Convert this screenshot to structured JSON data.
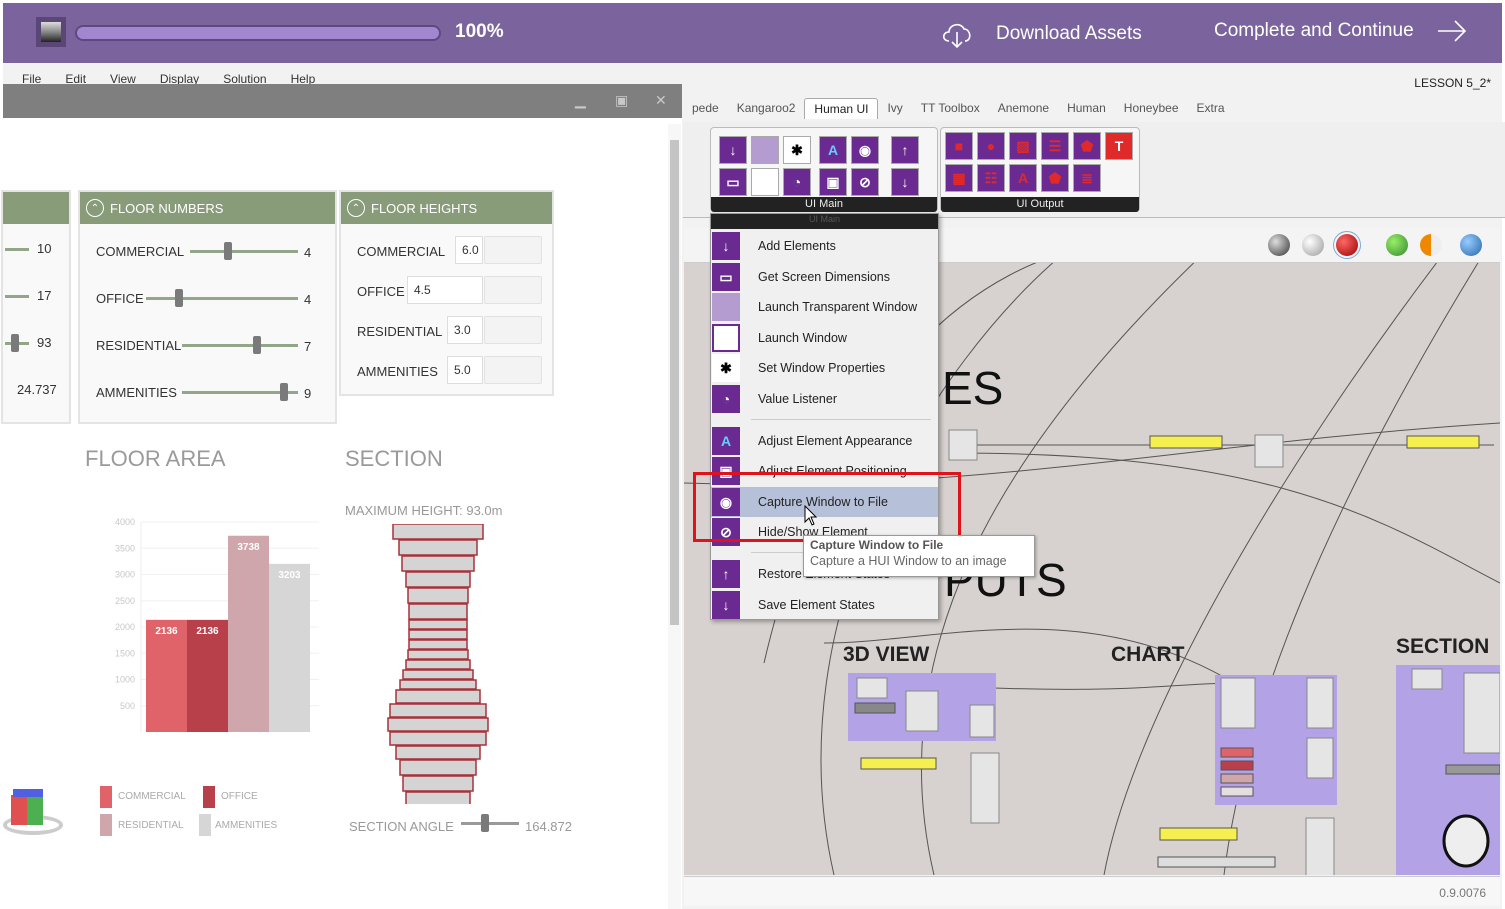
{
  "course_bar": {
    "progress_label": "100%",
    "progress": 1.0,
    "download_label": "Download Assets",
    "continue_label": "Complete and Continue",
    "bg_color": "#7b649d"
  },
  "grasshopper": {
    "menu": [
      "File",
      "Edit",
      "View",
      "Display",
      "Solution",
      "Help"
    ],
    "document_title": "LESSON 5_2*",
    "tabs": [
      "pede",
      "Kangaroo2",
      "Human UI",
      "Ivy",
      "TT Toolbox",
      "Anemone",
      "Human",
      "Honeybee",
      "Extra"
    ],
    "active_tab": "Human UI",
    "ribbon_groups": [
      {
        "label": "UI Main"
      },
      {
        "label": "UI Output"
      }
    ],
    "dropdown": {
      "header": "UI Main",
      "items": [
        {
          "label": "Add Elements",
          "icon": "arrow-down-icon"
        },
        {
          "label": "Get Screen Dimensions",
          "icon": "monitor-icon"
        },
        {
          "label": "Launch Transparent Window",
          "icon": "transparent-window-icon"
        },
        {
          "label": "Launch Window",
          "icon": "window-icon"
        },
        {
          "label": "Set Window Properties",
          "icon": "window-properties-icon"
        },
        {
          "label": "Value Listener",
          "icon": "listener-icon"
        },
        {
          "label": "Adjust Element Appearance",
          "icon": "appearance-icon"
        },
        {
          "label": "Adjust Element Positioning",
          "icon": "positioning-icon"
        },
        {
          "label": "Capture Window to File",
          "icon": "camera-icon"
        },
        {
          "label": "Hide/Show Element",
          "icon": "hide-eye-icon"
        },
        {
          "label": "Restore Element States",
          "icon": "arrow-up-icon"
        },
        {
          "label": "Save Element States",
          "icon": "arrow-down-icon"
        }
      ],
      "highlighted": "Capture Window to File"
    },
    "tooltip": {
      "title": "Capture Window to File",
      "description": "Capture a HUI Window to an image"
    },
    "canvas_labels": [
      "ES",
      "PUTS",
      "3D VIEW",
      "CHART",
      "SECTION"
    ],
    "status_version": "0.9.0076"
  },
  "hui_window": {
    "floor_numbers": {
      "title": "FLOOR NUMBERS",
      "rows": [
        {
          "label": "COMMERCIAL",
          "value": "4",
          "position": 0.35
        },
        {
          "label": "OFFICE",
          "value": "4",
          "position": 0.22
        },
        {
          "label": "RESIDENTIAL",
          "value": "7",
          "position": 0.65
        },
        {
          "label": "AMMENITIES",
          "value": "9",
          "position": 0.88
        }
      ]
    },
    "partial_panel": {
      "values": [
        "10",
        "17",
        "93",
        "24.737"
      ]
    },
    "floor_heights": {
      "title": "FLOOR HEIGHTS",
      "rows": [
        {
          "label": "COMMERCIAL",
          "value": "6.0"
        },
        {
          "label": "OFFICE",
          "value": "4.5"
        },
        {
          "label": "RESIDENTIAL",
          "value": "3.0"
        },
        {
          "label": "AMMENITIES",
          "value": "5.0"
        }
      ]
    },
    "floor_area_title": "FLOOR AREA",
    "section": {
      "title": "SECTION",
      "max_height": "MAXIMUM HEIGHT: 93.0m",
      "angle_label": "SECTION ANGLE",
      "angle_value": "164.872",
      "angle_position": 0.4
    },
    "legend": [
      {
        "label": "COMMERCIAL",
        "color": "#e0636a"
      },
      {
        "label": "OFFICE",
        "color": "#b8404a"
      },
      {
        "label": "RESIDENTIAL",
        "color": "#cfa6ab"
      },
      {
        "label": "AMMENITIES",
        "color": "#d6d6d6"
      }
    ]
  },
  "chart_data": {
    "type": "bar",
    "title": "FLOOR AREA",
    "categories": [
      "COMMERCIAL",
      "OFFICE",
      "RESIDENTIAL",
      "AMMENITIES"
    ],
    "values": [
      2136,
      2136,
      3738,
      3203
    ],
    "colors": [
      "#e0636a",
      "#b8404a",
      "#cfa6ab",
      "#d6d6d6"
    ],
    "yticks": [
      500,
      1000,
      1500,
      2000,
      2500,
      3000,
      3500,
      4000
    ],
    "ylim": [
      0,
      4000
    ],
    "grid": true,
    "xlabel": "",
    "ylabel": ""
  }
}
